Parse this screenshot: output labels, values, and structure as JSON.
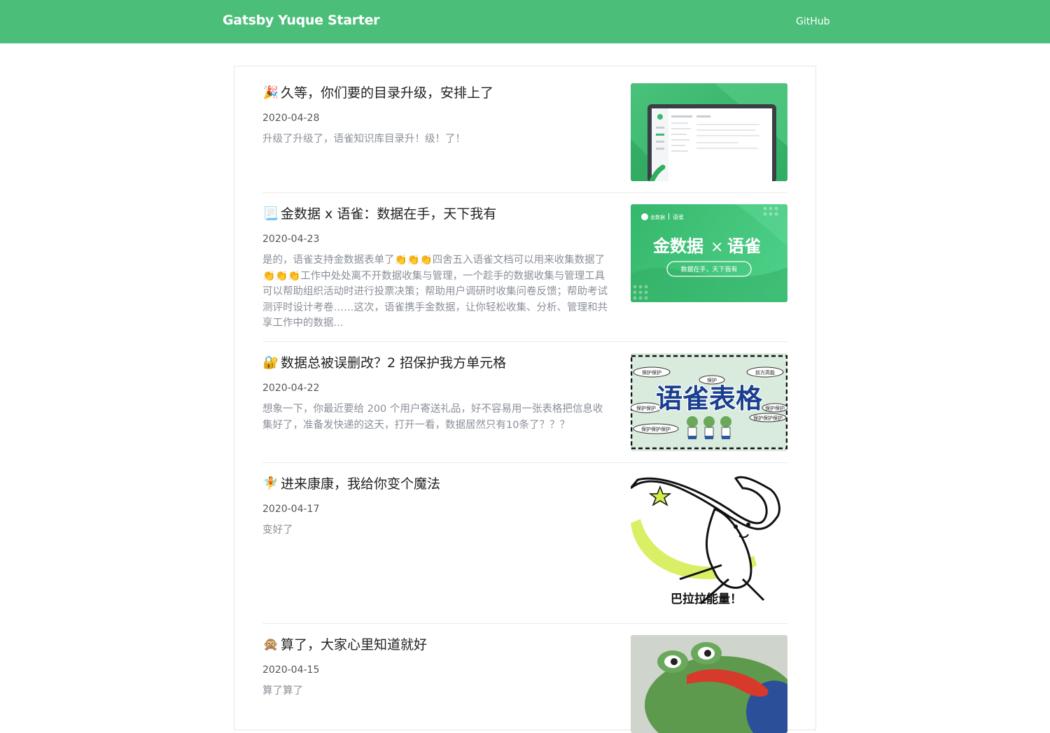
{
  "header": {
    "brand": "Gatsby Yuque Starter",
    "github": "GitHub",
    "bg_color": "#4bbe7a"
  },
  "posts": [
    {
      "emoji": "🎉",
      "title": "久等，你们要的目录升级，安排上了",
      "date": "2020-04-28",
      "summary": "升级了升级了，语雀知识库目录升！级！了！",
      "thumb": "laptop-screenshot"
    },
    {
      "emoji": "📃",
      "title": "金数据 x 语雀：数据在手，天下我有",
      "date": "2020-04-23",
      "summary": "是的，语雀支持金数据表单了👏👏👏四舍五入语雀文档可以用来收集数据了👏👏👏工作中处处离不开数据收集与管理，一个趁手的数据收集与管理工具可以帮助组织活动时进行投票决策；帮助用户调研时收集问卷反馈；帮助考试测评时设计考卷……这次，语雀携手金数据，让你轻松收集、分析、管理和共享工作中的数据...",
      "thumb": "banner",
      "thumb_brand_left": "金数据",
      "thumb_brand_right": "语雀",
      "thumb_title_left": "金数据",
      "thumb_title_x": "×",
      "thumb_title_right": "语雀",
      "thumb_pill": "数据在手，天下我有"
    },
    {
      "emoji": "🔐",
      "title": "数据总被误删改？2 招保护我方单元格",
      "date": "2020-04-22",
      "summary": "想象一下，你最近要给 200 个用户寄送礼品，好不容易用一张表格把信息收集好了，准备发快递的这天，打开一看，数据居然只有10条了？？？",
      "thumb": "sheet-meme",
      "thumb_title": "语雀表格",
      "thumb_tags": [
        "保护保护",
        "保护",
        "前方高能",
        "保护保护",
        "保护保护",
        "保护保护保护",
        "保护保护保护"
      ]
    },
    {
      "emoji": "🧚",
      "title": "进来康康，我给你变个魔法",
      "date": "2020-04-17",
      "summary": "变好了",
      "thumb": "rabbit-meme",
      "thumb_caption": "巴拉拉能量！"
    },
    {
      "emoji": "🙊",
      "title": "算了，大家心里知道就好",
      "date": "2020-04-15",
      "summary": "算了算了",
      "thumb": "frog-photo"
    }
  ]
}
